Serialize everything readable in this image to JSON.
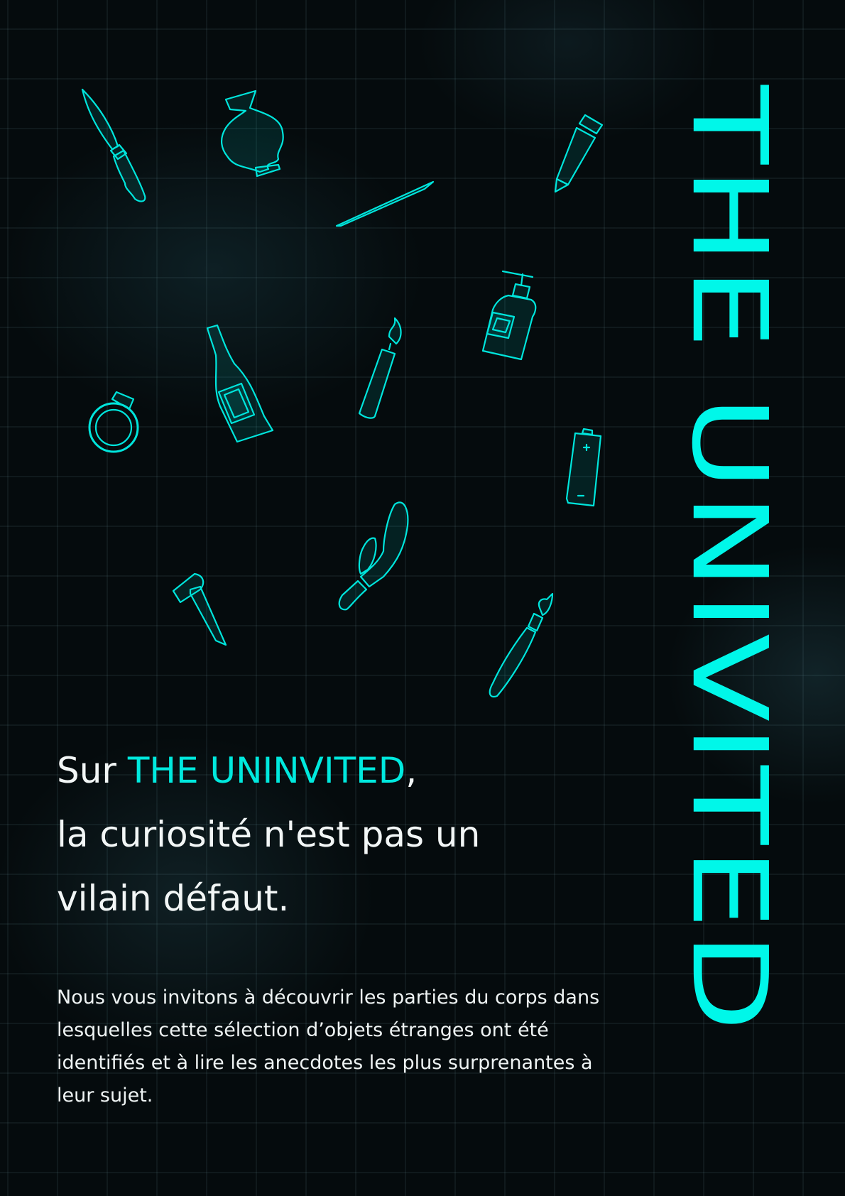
{
  "poster": {
    "vertical_title": "THE UNIVITED",
    "headline": {
      "line1_prefix": "Sur ",
      "line1_accent": "THE UNINVITED",
      "line1_suffix": ",",
      "line2": "la curiosité n'est pas un",
      "line3": "vilain défaut."
    },
    "body": "Nous vous invitons à découvrir les parties du corps dans lesquelles cette sélection d’objets étranges ont été identifiés et à lire les anecdotes les plus surprenantes à leur sujet.",
    "icons": [
      "knife-icon",
      "vase-icon",
      "pencil-icon",
      "needle-icon",
      "soap-bottle-icon",
      "wine-bottle-icon",
      "candle-icon",
      "ring-icon",
      "battery-icon",
      "vibrator-icon",
      "nail-icon",
      "paintbrush-icon"
    ],
    "colors": {
      "accent": "#00f7e9",
      "background": "#050b0d",
      "text": "#f2f6f6"
    }
  }
}
